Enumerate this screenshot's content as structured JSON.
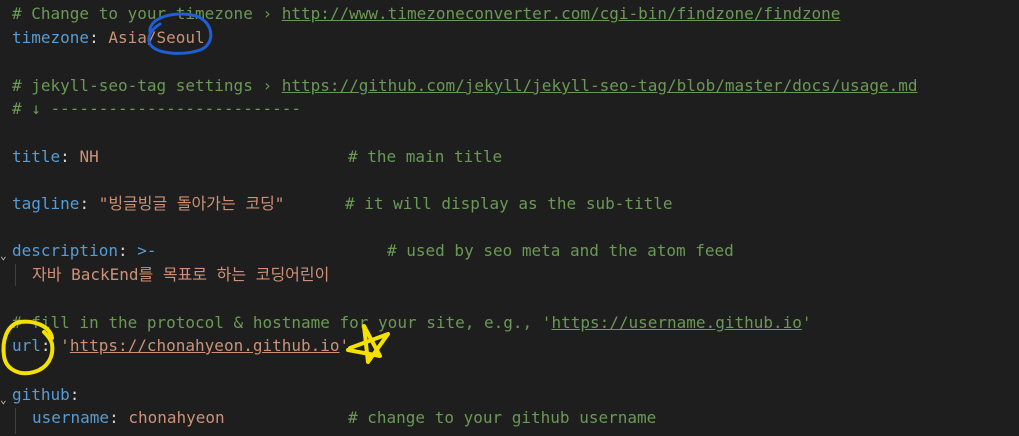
{
  "editor": {
    "lines": {
      "tz_comment_prefix": "# Change to your timezone › ",
      "tz_comment_url": "http://www.timezoneconverter.com/cgi-bin/findzone/findzone",
      "tz_key": "timezone",
      "tz_colon": ": ",
      "tz_value": "Asia/Seoul",
      "seo_comment_prefix": "# jekyll-seo-tag settings › ",
      "seo_comment_url": "https://github.com/jekyll/jekyll-seo-tag/blob/master/docs/usage.md",
      "seo_divider": "# ↓ --------------------------",
      "title_key": "title",
      "title_colon": ": ",
      "title_value": "NH",
      "title_comment": "# the main title",
      "tagline_key": "tagline",
      "tagline_colon": ": ",
      "tagline_value": "\"빙글빙글 돌아가는 코딩\"",
      "tagline_comment": "# it will display as the sub-title",
      "description_key": "description",
      "description_colon": ": ",
      "description_value": ">-",
      "description_comment": "# used by seo meta and the atom feed",
      "description_text": "자바 BackEnd를 목표로 하는 코딩어린이",
      "url_comment_prefix": "# fill in the protocol & hostname for your site, e.g., '",
      "url_comment_url": "https://username.github.io",
      "url_comment_suffix": "'",
      "url_key": "url",
      "url_colon": ": ",
      "url_quote_open": "'",
      "url_value": "https://chonahyeon.github.io",
      "url_quote_close": "'",
      "github_key": "github",
      "github_colon": ":",
      "username_key": "username",
      "username_colon": ": ",
      "username_value": "chonahyeon",
      "username_comment": "# change to your github username"
    },
    "fold_marker": "⌄"
  },
  "colors": {
    "background": "#1e1e1e",
    "comment": "#6a9955",
    "key": "#569cd6",
    "string": "#ce9178",
    "punctuation": "#d4d4d4",
    "annotation_blue": "#1f5fd6",
    "annotation_yellow": "#f5e100"
  },
  "annotations": {
    "blue_circle_icon": "blue-ellipse-around-seoul",
    "yellow_circle_icon": "yellow-circle-around-url",
    "yellow_star_icon": "yellow-star"
  }
}
